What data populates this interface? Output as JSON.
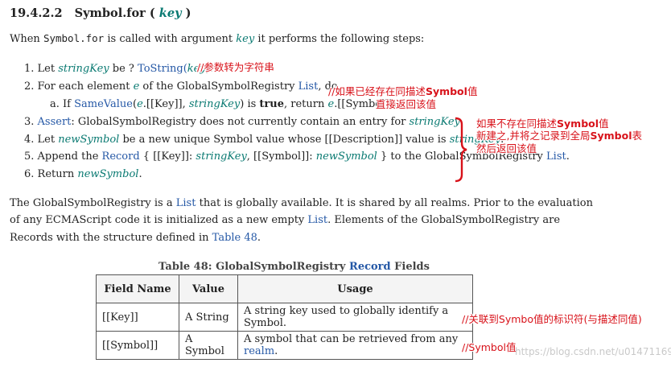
{
  "heading": {
    "section": "19.4.2.2",
    "title": "Symbol.for (",
    "param": "key",
    "close": ")"
  },
  "intro": {
    "when": "When",
    "code": "Symbol.for",
    "called": "is called with argument",
    "arg": "key",
    "rest": "it performs the following steps:"
  },
  "steps": {
    "s1": {
      "num": "1.",
      "let": "Let",
      "var": "stringKey",
      "be": "be ?",
      "func": "ToString",
      "open": "(",
      "arg": "key",
      "close": ")."
    },
    "s2": {
      "num": "2.",
      "text": "For each element",
      "var": "e",
      "text2": "of the GlobalSymbolRegistry",
      "link": "List",
      "text3": ", do"
    },
    "s2a": {
      "num": "a.",
      "text": "If",
      "func": "SameValue",
      "open": "(",
      "var": "e",
      "mid": ".[[Key]],",
      "var2": "stringKey",
      "mid2": ") is",
      "bold": "true",
      "mid3": ", return",
      "var3": "e",
      "end": ".[[Symbol]]."
    },
    "s3": {
      "num": "3.",
      "link": "Assert",
      "text": ": GlobalSymbolRegistry does not currently contain an entry for",
      "var": "stringKey",
      "end": "."
    },
    "s4": {
      "num": "4.",
      "text": "Let",
      "var": "newSymbol",
      "text2": "be a new unique Symbol value whose [[Description]] value is",
      "var2": "stringKey",
      "end": "."
    },
    "s5": {
      "num": "5.",
      "text": "Append the",
      "link": "Record",
      "text2": "{ [[Key]]:",
      "var": "stringKey",
      "text3": ", [[Symbol]]:",
      "var2": "newSymbol",
      "text4": "} to the GlobalSymbolRegistry",
      "link2": "List",
      "end": "."
    },
    "s6": {
      "num": "6.",
      "text": "Return",
      "var": "newSymbol",
      "end": "."
    }
  },
  "paragraph": {
    "l1a": "The GlobalSymbolRegistry is a",
    "l1link": "List",
    "l1b": "that is globally available. It is shared by all realms. Prior to the evaluation",
    "l2a": "of any ECMAScript code it is initialized as a new empty",
    "l2link": "List",
    "l2b": ". Elements of the GlobalSymbolRegistry are",
    "l3a": "Records with the structure defined in",
    "l3link": "Table 48",
    "l3b": "."
  },
  "table": {
    "caption_a": "Table 48: GlobalSymbolRegistry",
    "caption_link": "Record",
    "caption_b": "Fields",
    "headers": [
      "Field Name",
      "Value",
      "Usage"
    ],
    "rows": [
      {
        "field": "[[Key]]",
        "value": "A String",
        "usage": "A string key used to globally identify a Symbol."
      },
      {
        "field": "[[Symbol]]",
        "value": "A Symbol",
        "usage": "A symbol that can be retrieved from any",
        "usage_link": "realm",
        "usage_end": "."
      }
    ]
  },
  "annotations": {
    "n1": "//参数转为字符串",
    "n2a_pre": "//如果已经存在同描述",
    "n2a_bold": "Symbol",
    "n2a_post": "值",
    "n2b": "直接返回该值",
    "n3a_pre": "如果不存在同描述",
    "n3a_bold": "Symbol",
    "n3a_post": "值",
    "n3b_pre": "新建之,并将之记录到全局",
    "n3b_bold": "Symbol",
    "n3b_post": "表",
    "n3c": "然后返回该值",
    "n4": "//关联到Symbo值的标识符(与描述同值)",
    "n5": "//Symbol值"
  },
  "watermark": "https://blog.csdn.net/u014711690",
  "colors": {
    "annotation": "#d8121a",
    "link": "#2558a6",
    "variable": "#0a7a72"
  }
}
